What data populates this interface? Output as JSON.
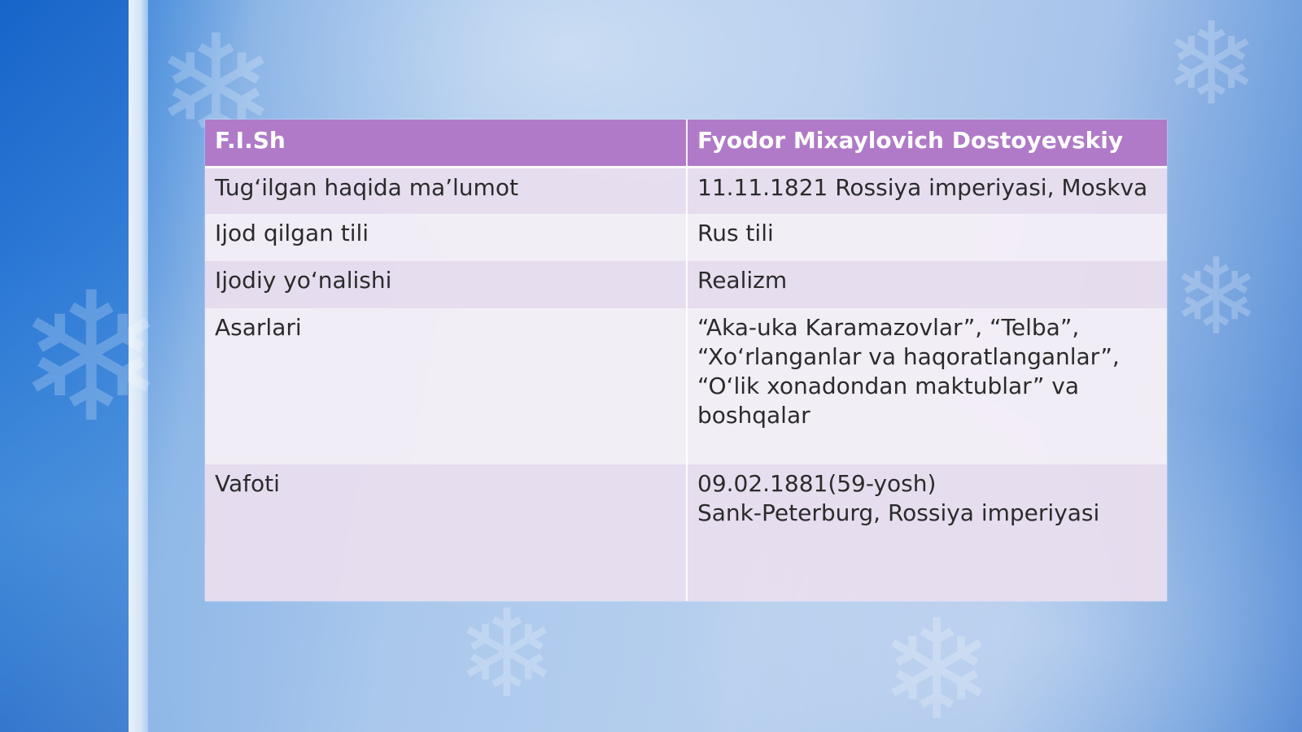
{
  "table": {
    "header": {
      "col1": "F.I.Sh",
      "col2": "Fyodor Mixaylovich Dostoyevskiy"
    },
    "rows": [
      {
        "label": "Tug‘ilgan haqida ma’lumot",
        "value": [
          "11.11.1821 Rossiya imperiyasi, Moskva"
        ]
      },
      {
        "label": "Ijod qilgan tili",
        "value": [
          "Rus tili"
        ]
      },
      {
        "label": "Ijodiy yo‘nalishi",
        "value": [
          "Realizm"
        ]
      },
      {
        "label": "Asarlari",
        "value": [
          "“Aka-uka Karamazovlar”, “Telba”,",
          "“Xo‘rlanganlar va haqoratlanganlar”,",
          "“O‘lik xonadondan maktublar” va",
          "boshqalar"
        ]
      },
      {
        "label": "Vafoti",
        "value": [
          "09.02.1881(59-yosh)",
          "Sank-Peterburg, Rossiya imperiyasi"
        ]
      }
    ]
  },
  "colors": {
    "header_bg": "#b07ac8",
    "header_text": "#ffffff",
    "row_odd": "#e8deee",
    "row_even": "#f4eef6",
    "background": "#aac8ec"
  },
  "decor": {
    "snowflake_icon": "❄"
  }
}
